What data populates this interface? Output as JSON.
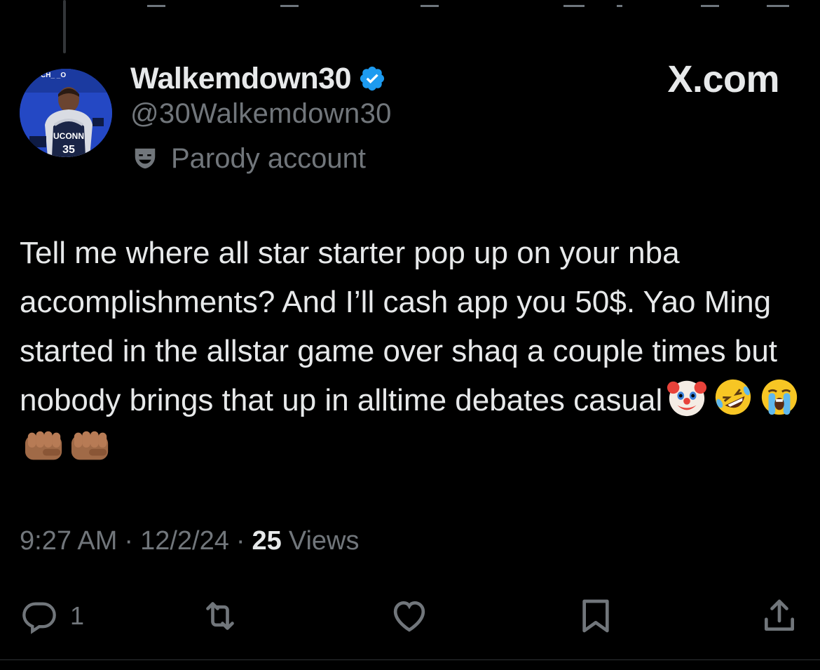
{
  "colors": {
    "background": "#000000",
    "primary_text": "#e7e9ea",
    "secondary_text": "#71767b",
    "verified_badge": "#1d9bf0"
  },
  "brand": {
    "label": "X.com"
  },
  "author": {
    "display_name": "Walkemdown30",
    "handle": "@30Walkemdown30",
    "verified": true,
    "verified_icon": "verified-badge-icon",
    "account_label": "Parody account",
    "account_label_icon": "theater-mask-icon",
    "avatar_jersey_text": "UCONN",
    "avatar_jersey_number": "35",
    "avatar_backdrop_text": "CH_ _O"
  },
  "tweet": {
    "text": "Tell me where all star starter pop up on your nba accomplishments? And I’ll cash app you 50$. Yao Ming started in the allstar game over shaq a couple times but nobody brings that up in alltime debates casual",
    "emojis": [
      "clown-face",
      "rolling-on-floor-laughing",
      "loudly-crying-face",
      "oncoming-fist",
      "oncoming-fist"
    ]
  },
  "meta": {
    "time": "9:27 AM",
    "date": "12/2/24",
    "views_count": "25",
    "views_label": "Views",
    "separator": "·"
  },
  "actions": {
    "reply_icon": "reply-icon",
    "reply_count": "1",
    "repost_icon": "repost-icon",
    "like_icon": "heart-icon",
    "bookmark_icon": "bookmark-icon",
    "share_icon": "share-icon"
  }
}
